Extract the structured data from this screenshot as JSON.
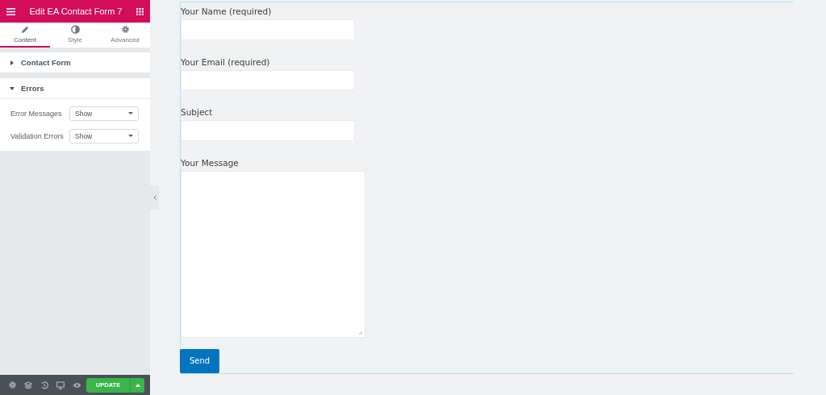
{
  "panel": {
    "title": "Edit EA Contact Form 7",
    "tabs": [
      {
        "label": "Content",
        "selected": true
      },
      {
        "label": "Style",
        "selected": false
      },
      {
        "label": "Advanced",
        "selected": false
      }
    ],
    "sections": [
      {
        "title": "Contact Form",
        "expanded": false
      },
      {
        "title": "Errors",
        "expanded": true,
        "controls": [
          {
            "label": "Error Messages",
            "value": "Show"
          },
          {
            "label": "Validation Errors",
            "value": "Show"
          }
        ]
      }
    ],
    "footer": {
      "update_label": "UPDATE"
    }
  },
  "form": {
    "fields": [
      {
        "label": "Your Name (required)",
        "kind": "input"
      },
      {
        "label": "Your Email (required)",
        "kind": "input"
      },
      {
        "label": "Subject",
        "kind": "input"
      },
      {
        "label": "Your Message",
        "kind": "textarea"
      }
    ],
    "submit": "Send"
  }
}
